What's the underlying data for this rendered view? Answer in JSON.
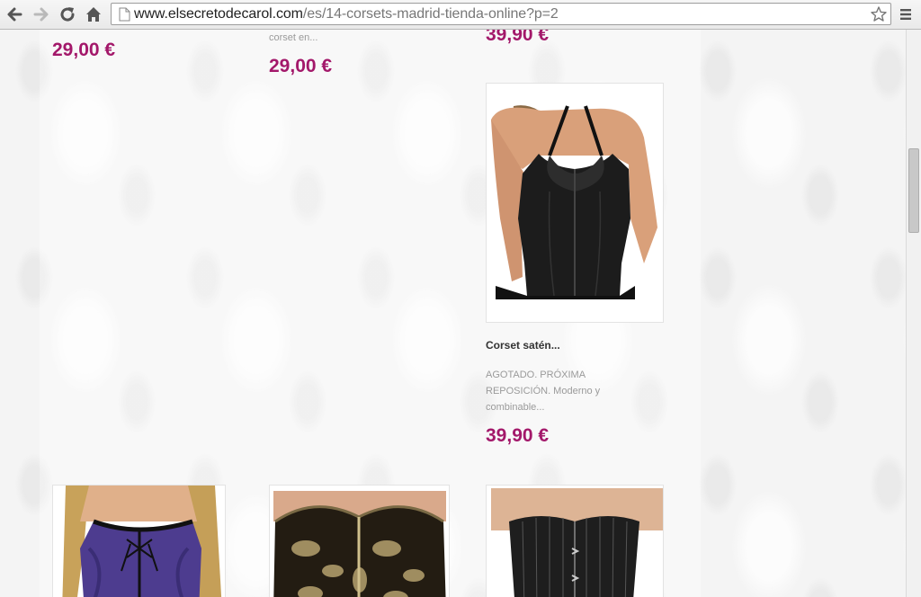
{
  "browser": {
    "url_host": "www.elsecretodecarol.com",
    "url_path": "/es/14-corsets-madrid-tienda-online?p=2"
  },
  "products_top": [
    {
      "price": "29,00 €"
    },
    {
      "snippet": "corset en...",
      "price": "29,00 €"
    },
    {
      "price": "39,90 €"
    }
  ],
  "featured": {
    "title": "Corset satén...",
    "description": "AGOTADO. PRÓXIMA REPOSICIÓN. Moderno y combinable...",
    "price": "39,90 €",
    "image": "black-satin-corset-photo"
  },
  "products_bottom": [
    {
      "image": "purple-lace-corset-photo"
    },
    {
      "image": "gold-brocade-corset-photo"
    },
    {
      "image": "black-pinstripe-corset-photo"
    }
  ],
  "colors": {
    "price": "#a3186a",
    "background": "#f4f4f4"
  }
}
